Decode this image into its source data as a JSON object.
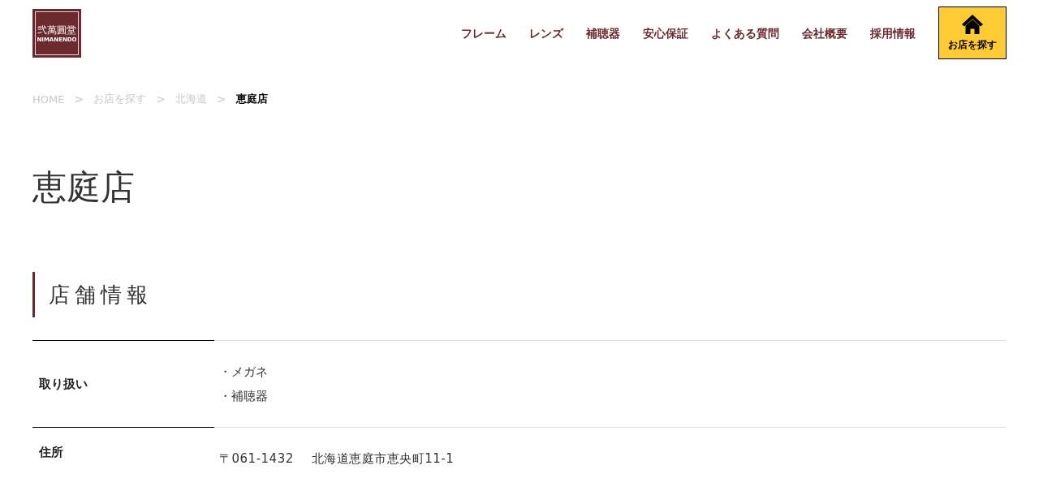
{
  "header": {
    "logo": {
      "name": "弐萬圓堂",
      "romaji": "NIMANENDO"
    },
    "nav": [
      {
        "label": "フレーム"
      },
      {
        "label": "レンズ"
      },
      {
        "label": "補聴器"
      },
      {
        "label": "安心保証"
      },
      {
        "label": "よくある質問"
      },
      {
        "label": "会社概要"
      },
      {
        "label": "採用情報"
      }
    ],
    "store_button": {
      "label": "お店を探す"
    }
  },
  "breadcrumb": [
    {
      "kind": "link",
      "label": "HOME",
      "current": false
    },
    {
      "kind": "separator",
      "label": ">"
    },
    {
      "kind": "link",
      "label": "お店を探す",
      "current": false
    },
    {
      "kind": "separator",
      "label": ">"
    },
    {
      "kind": "link",
      "label": "北海道",
      "current": false
    },
    {
      "kind": "separator",
      "label": ">"
    },
    {
      "kind": "link",
      "label": "恵庭店",
      "current": true
    }
  ],
  "page_title": "恵庭店",
  "section": {
    "heading": "店舗情報",
    "rows": [
      {
        "kind": "list",
        "label": "取り扱い",
        "values": [
          "・メガネ",
          "・補聴器"
        ]
      },
      {
        "kind": "address",
        "label": "住所",
        "postal_code": "〒061-1432",
        "address": "北海道恵庭市恵央町11-1"
      }
    ]
  }
}
